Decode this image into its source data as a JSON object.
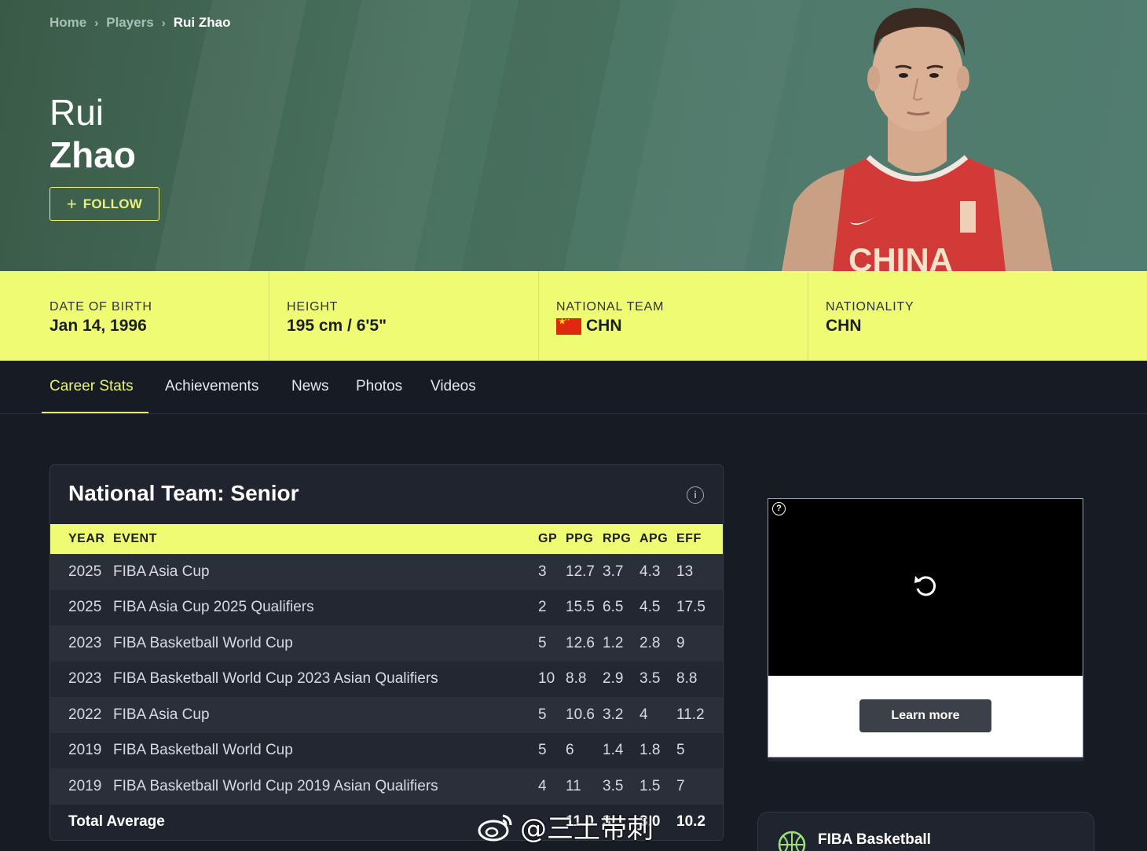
{
  "breadcrumb": {
    "home": "Home",
    "players": "Players",
    "current": "Rui Zhao"
  },
  "player": {
    "first_name": "Rui",
    "last_name": "Zhao"
  },
  "follow_label": "FOLLOW",
  "info": {
    "dob_label": "DATE OF BIRTH",
    "dob_value": "Jan 14, 1996",
    "height_label": "HEIGHT",
    "height_value": "195 cm / 6'5\"",
    "team_label": "NATIONAL TEAM",
    "team_value": "CHN",
    "nationality_label": "NATIONALITY",
    "nationality_value": "CHN"
  },
  "tabs": [
    "Career Stats",
    "Achievements",
    "News",
    "Photos",
    "Videos"
  ],
  "stats": {
    "title": "National Team: Senior",
    "headers": [
      "YEAR",
      "EVENT",
      "GP",
      "PPG",
      "RPG",
      "APG",
      "EFF"
    ],
    "rows": [
      [
        "2025",
        "FIBA Asia Cup",
        "3",
        "12.7",
        "3.7",
        "4.3",
        "13"
      ],
      [
        "2025",
        "FIBA Asia Cup 2025 Qualifiers",
        "2",
        "15.5",
        "6.5",
        "4.5",
        "17.5"
      ],
      [
        "2023",
        "FIBA Basketball World Cup",
        "5",
        "12.6",
        "1.2",
        "2.8",
        "9"
      ],
      [
        "2023",
        "FIBA Basketball World Cup 2023 Asian Qualifiers",
        "10",
        "8.8",
        "2.9",
        "3.5",
        "8.8"
      ],
      [
        "2022",
        "FIBA Asia Cup",
        "5",
        "10.6",
        "3.2",
        "4",
        "11.2"
      ],
      [
        "2019",
        "FIBA Basketball World Cup",
        "5",
        "6",
        "1.4",
        "1.8",
        "5"
      ],
      [
        "2019",
        "FIBA Basketball World Cup 2019 Asian Qualifiers",
        "4",
        "11",
        "3.5",
        "1.5",
        "7"
      ]
    ],
    "total": {
      "label": "Total Average",
      "ppg": "11.0",
      "rpg": "3.",
      "apg": "3.0",
      "eff": "10.2"
    }
  },
  "ad": {
    "help": "?",
    "cta": "Learn more"
  },
  "fiba_card": {
    "name": "FIBA Basketball"
  },
  "watermark": "@三土带刺",
  "colors": {
    "accent": "#f0fb74",
    "hero": "#4a7361",
    "background": "#161b24"
  }
}
